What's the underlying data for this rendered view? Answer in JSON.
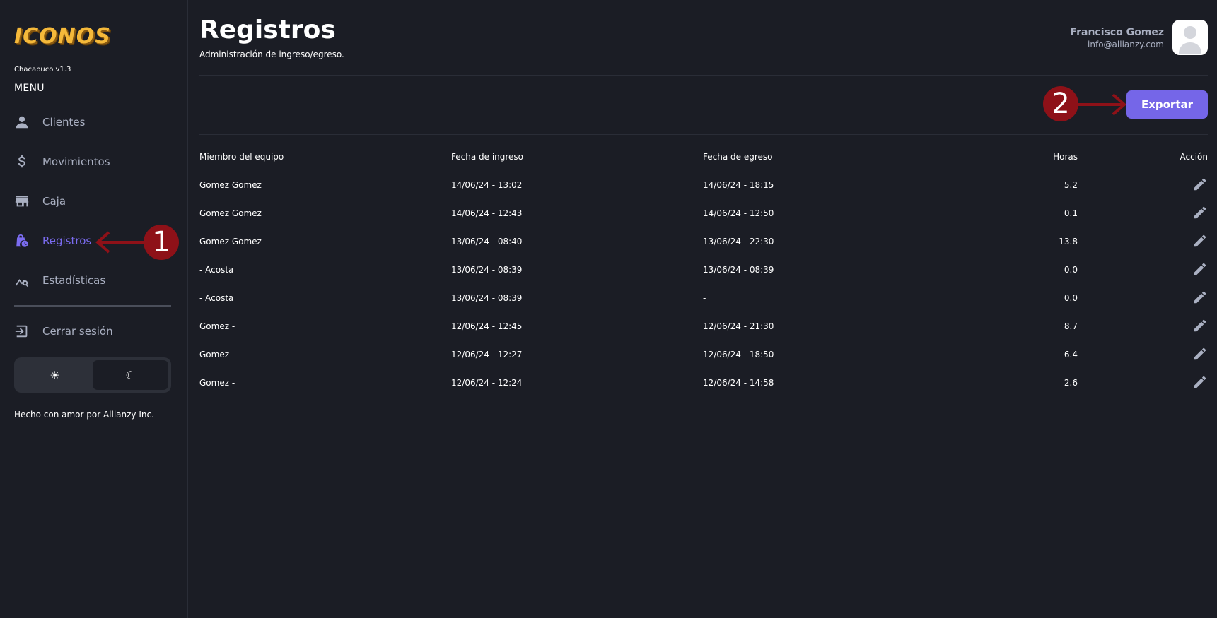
{
  "sidebar": {
    "logo": "ICONOS",
    "version": "Chacabuco v1.3",
    "menu_title": "MENU",
    "items": [
      {
        "label": "Clientes",
        "icon": "person-icon"
      },
      {
        "label": "Movimientos",
        "icon": "dollar-icon"
      },
      {
        "label": "Caja",
        "icon": "store-icon"
      },
      {
        "label": "Registros",
        "icon": "clock-bag-icon",
        "active": true
      },
      {
        "label": "Estadísticas",
        "icon": "chart-search-icon"
      }
    ],
    "logout_label": "Cerrar sesión",
    "theme": {
      "light_icon": "☀",
      "dark_icon": "☾",
      "active": "dark"
    },
    "credit": "Hecho con amor por Allianzy Inc."
  },
  "header": {
    "title": "Registros",
    "subtitle": "Administración de ingreso/egreso.",
    "user_name": "Francisco Gomez",
    "user_email": "info@allianzy.com"
  },
  "toolbar": {
    "export_label": "Exportar"
  },
  "annotations": {
    "marker1": "1",
    "marker2": "2"
  },
  "table": {
    "headers": [
      "Miembro del equipo",
      "Fecha de ingreso",
      "Fecha de egreso",
      "Horas",
      "Acción"
    ],
    "rows": [
      [
        "Gomez Gomez",
        "14/06/24 - 13:02",
        "14/06/24 - 18:15",
        "5.2"
      ],
      [
        "Gomez Gomez",
        "14/06/24 - 12:43",
        "14/06/24 - 12:50",
        "0.1"
      ],
      [
        "Gomez Gomez",
        "13/06/24 - 08:40",
        "13/06/24 - 22:30",
        "13.8"
      ],
      [
        "- Acosta",
        "13/06/24 - 08:39",
        "13/06/24 - 08:39",
        "0.0"
      ],
      [
        "- Acosta",
        "13/06/24 - 08:39",
        "-",
        "0.0"
      ],
      [
        "Gomez -",
        "12/06/24 - 12:45",
        "12/06/24 - 21:30",
        "8.7"
      ],
      [
        "Gomez -",
        "12/06/24 - 12:27",
        "12/06/24 - 18:50",
        "6.4"
      ],
      [
        "Gomez -",
        "12/06/24 - 12:24",
        "12/06/24 - 14:58",
        "2.6"
      ]
    ]
  },
  "colors": {
    "accent": "#7566e8",
    "active_nav": "#7b6cf0",
    "marker": "#8e1118",
    "background": "#1b1d25"
  }
}
